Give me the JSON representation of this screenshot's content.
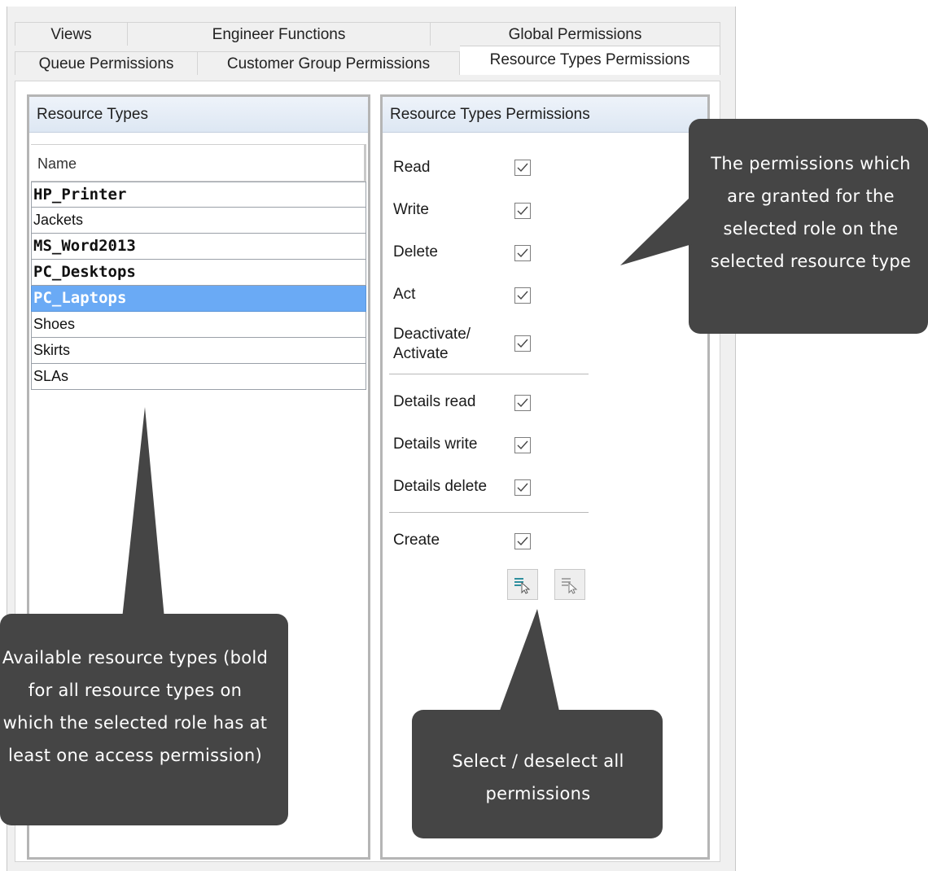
{
  "tabs_row1": [
    {
      "label": "Views"
    },
    {
      "label": "Engineer Functions"
    },
    {
      "label": "Global Permissions"
    }
  ],
  "tabs_row2": [
    {
      "label": "Queue Permissions"
    },
    {
      "label": "Customer Group Permissions"
    },
    {
      "label": "Resource Types Permissions",
      "active": true
    }
  ],
  "left_panel": {
    "title": "Resource Types",
    "column_header": "Name",
    "rows": [
      {
        "name": "HP_Printer",
        "bold": true
      },
      {
        "name": "Jackets",
        "bold": false
      },
      {
        "name": "MS_Word2013",
        "bold": true
      },
      {
        "name": "PC_Desktops",
        "bold": true
      },
      {
        "name": "PC_Laptops",
        "bold": true,
        "selected": true
      },
      {
        "name": "Shoes",
        "bold": false
      },
      {
        "name": "Skirts",
        "bold": false
      },
      {
        "name": "SLAs",
        "bold": false
      }
    ]
  },
  "right_panel": {
    "title": "Resource Types Permissions",
    "permissions": [
      {
        "label": "Read",
        "checked": true
      },
      {
        "label": "Write",
        "checked": true
      },
      {
        "label": "Delete",
        "checked": true
      },
      {
        "label": "Act",
        "checked": true
      },
      {
        "label": "Deactivate/\nActivate",
        "checked": true
      },
      {
        "label": "Details read",
        "checked": true
      },
      {
        "label": "Details write",
        "checked": true
      },
      {
        "label": "Details delete",
        "checked": true
      },
      {
        "label": "Create",
        "checked": true
      }
    ],
    "buttons": [
      {
        "icon": "select-all-icon"
      },
      {
        "icon": "deselect-all-icon"
      }
    ]
  },
  "callouts": {
    "permissions": "The permissions which are granted for the selected role on the selected resource type",
    "resource_types": "Available resource types (bold for all resource types on which the selected role has at least one access permission)",
    "select_deselect": "Select / deselect all permissions"
  },
  "colors": {
    "selection": "#6aaaf5",
    "callout": "#454545",
    "header_gradient": "#dde7f3"
  }
}
